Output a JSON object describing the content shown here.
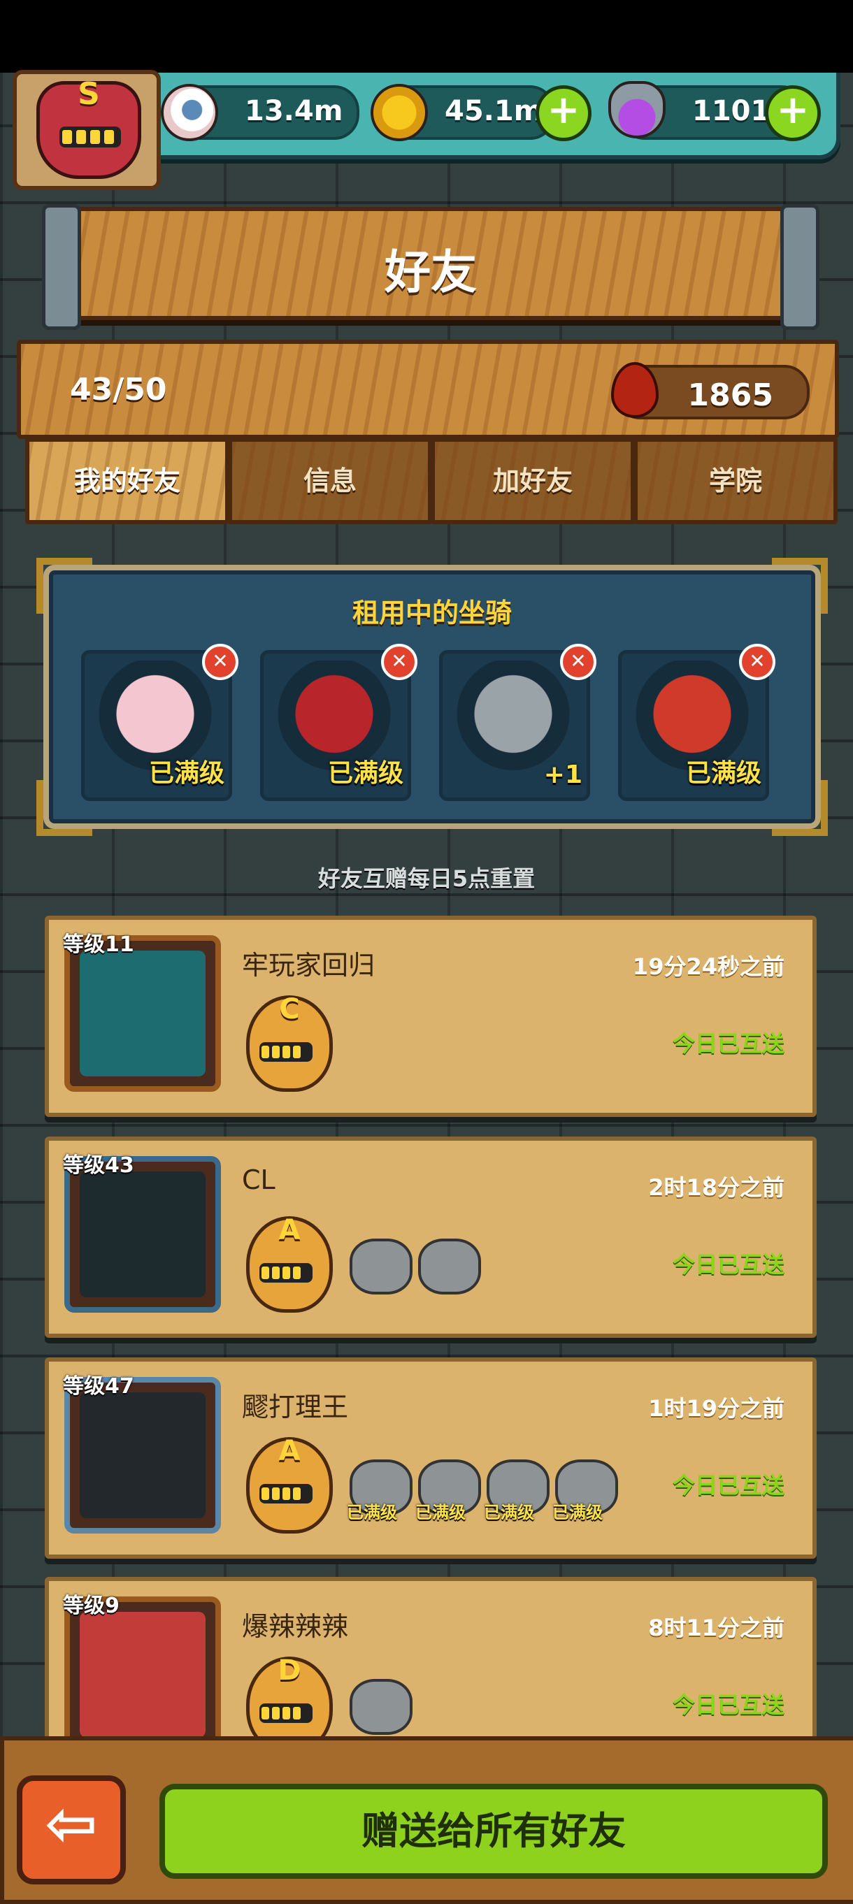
{
  "resources": {
    "eyes": "13.4m",
    "coins": "45.1m",
    "potions": "1101"
  },
  "player": {
    "grade": "S"
  },
  "page_title": "好友",
  "friend_count": "43/50",
  "blood_points": "1865",
  "tabs": [
    "我的好友",
    "信息",
    "加好友",
    "学院"
  ],
  "active_tab": "我的好友",
  "rented_mounts": {
    "title": "租用中的坐骑",
    "slots": [
      {
        "label": "已满级",
        "color": "#f4c6cf"
      },
      {
        "label": "已满级",
        "color": "#b8262c"
      },
      {
        "label": "+1",
        "color": "#9aa3a8"
      },
      {
        "label": "已满级",
        "color": "#cf3a2a"
      }
    ]
  },
  "reset_note": "好友互赠每日5点重置",
  "friends": [
    {
      "level": "等级11",
      "name": "牢玩家回归",
      "time": "19分24秒之前",
      "status": "今日已互送",
      "grade": "C",
      "portrait_color": "#1c6c70",
      "frame_color": "#9a5a1e",
      "mounts": []
    },
    {
      "level": "等级43",
      "name": "CL",
      "time": "2时18分之前",
      "status": "今日已互送",
      "grade": "A",
      "portrait_color": "#1d2a2e",
      "frame_color": "#3a6a8a",
      "mounts": [
        {
          "label": ""
        },
        {
          "label": ""
        }
      ]
    },
    {
      "level": "等级47",
      "name": "飂打理王",
      "time": "1时19分之前",
      "status": "今日已互送",
      "grade": "A",
      "portrait_color": "#22282c",
      "frame_color": "#5a86a8",
      "mounts": [
        {
          "label": "已满级"
        },
        {
          "label": "已满级"
        },
        {
          "label": "已满级"
        },
        {
          "label": "已满级"
        }
      ]
    },
    {
      "level": "等级9",
      "name": "爆辣辣辣",
      "time": "8时11分之前",
      "status": "今日已互送",
      "grade": "D",
      "portrait_color": "#c23d3a",
      "frame_color": "#9a5a1e",
      "mounts": [
        {
          "label": ""
        }
      ]
    }
  ],
  "bottom": {
    "back_icon": "arrow-left-icon",
    "gift_all_label": "赠送给所有好友"
  },
  "colors": {
    "accent_green": "#8ed21d",
    "wood": "#c98c3f",
    "gold_text": "#ffd53a",
    "status_green": "#8cd61a"
  }
}
